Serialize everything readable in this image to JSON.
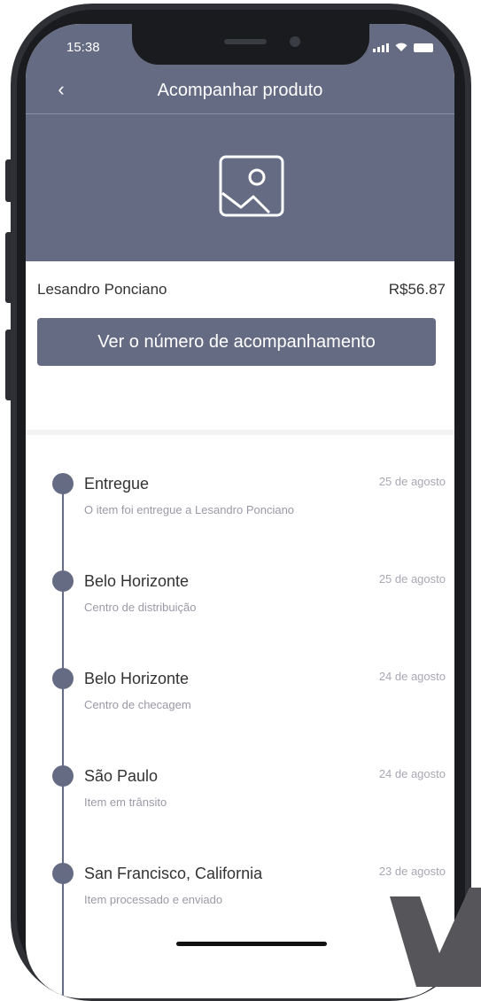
{
  "status_bar": {
    "time": "15:38"
  },
  "header": {
    "back_icon": "chevron-left-icon",
    "title": "Acompanhar produto",
    "product_image_icon": "image-placeholder-icon"
  },
  "order": {
    "customer_name": "Lesandro Ponciano",
    "price": "R$56.87",
    "tracking_button_label": "Ver o número de acompanhamento"
  },
  "timeline": [
    {
      "title": "Entregue",
      "description": "O item foi entregue a Lesandro Ponciano",
      "date": "25 de agosto"
    },
    {
      "title": "Belo Horizonte",
      "description": "Centro de distribuição",
      "date": "25 de agosto"
    },
    {
      "title": "Belo Horizonte",
      "description": "Centro de checagem",
      "date": "24 de agosto"
    },
    {
      "title": "São Paulo",
      "description": "Item em trânsito",
      "date": "24 de agosto"
    },
    {
      "title": "San Francisco, California",
      "description": "Item processado e enviado",
      "date": "23 de agosto"
    }
  ],
  "colors": {
    "accent": "#666b84",
    "frame": "#2e3035",
    "text": "#333333",
    "muted": "#9a9aa6"
  }
}
